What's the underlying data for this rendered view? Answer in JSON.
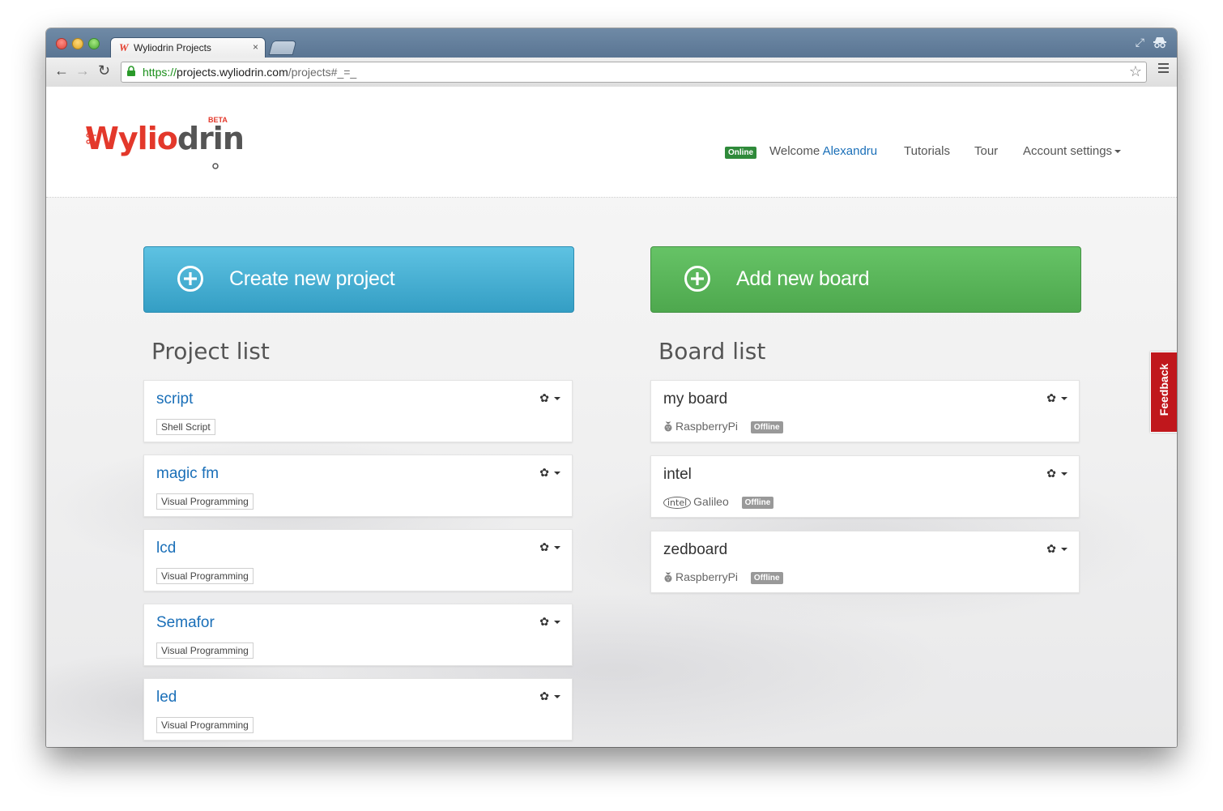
{
  "browser": {
    "tab_title": "Wyliodrin Projects",
    "tab_close": "×",
    "favicon": "W",
    "url_scheme": "https://",
    "url_host": "projects.wyliodrin.com",
    "url_path": "/projects#_=_",
    "back": "←",
    "forward": "→",
    "reload": "↻",
    "star": "☆",
    "restore": "⤢"
  },
  "header": {
    "logo_part1": "Wyli",
    "logo_part2": "o",
    "logo_part3": "drin",
    "logo_badge": "BETA",
    "status_badge": "Online",
    "welcome_prefix": "Welcome ",
    "user_name": "Alexandru",
    "nav_tutorials": "Tutorials",
    "nav_tour": "Tour",
    "nav_account": "Account settings"
  },
  "actions": {
    "create_project": "Create new project",
    "add_board": "Add new board"
  },
  "projects": {
    "title": "Project list",
    "items": [
      {
        "name": "script",
        "type": "Shell Script"
      },
      {
        "name": "magic fm",
        "type": "Visual Programming"
      },
      {
        "name": "lcd",
        "type": "Visual Programming"
      },
      {
        "name": "Semafor",
        "type": "Visual Programming"
      },
      {
        "name": "led",
        "type": "Visual Programming"
      }
    ]
  },
  "boards": {
    "title": "Board list",
    "items": [
      {
        "name": "my board",
        "type": "RaspberryPi",
        "status": "Offline"
      },
      {
        "name": "intel",
        "type_brand": "intel",
        "type": "Galileo",
        "status": "Offline"
      },
      {
        "name": "zedboard",
        "type": "RaspberryPi",
        "status": "Offline"
      }
    ]
  },
  "feedback": "Feedback",
  "gear_glyph": "✿",
  "colors": {
    "brand_red": "#e3382b",
    "link_blue": "#1a6fb8",
    "btn_blue": "#45b0d6",
    "btn_green": "#5bb75b",
    "online_green": "#2f8a3a",
    "offline_gray": "#999999",
    "feedback_red": "#c0171c"
  }
}
